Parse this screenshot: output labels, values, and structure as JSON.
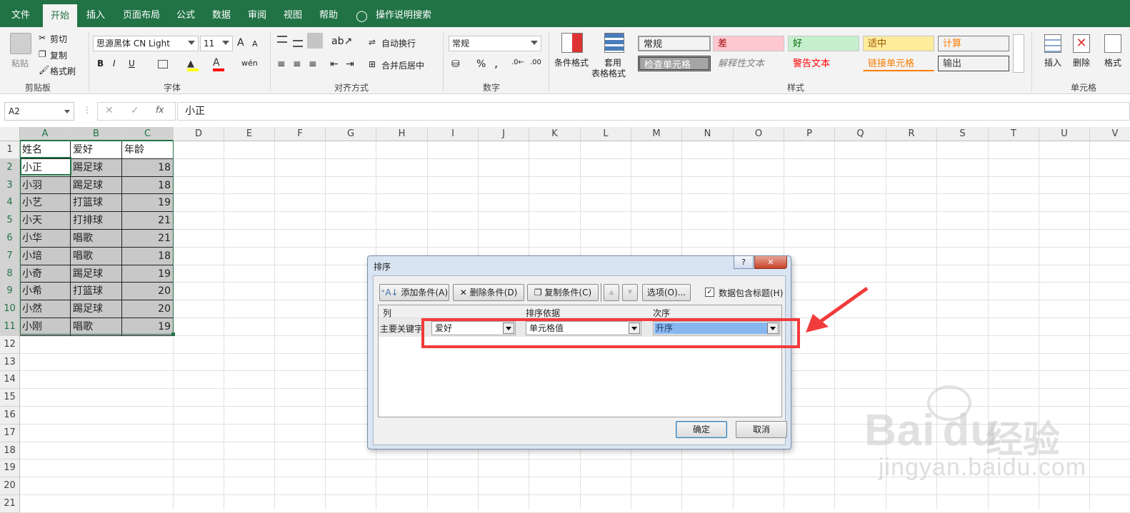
{
  "ribbon_tabs": [
    "文件",
    "开始",
    "插入",
    "页面布局",
    "公式",
    "数据",
    "审阅",
    "视图",
    "帮助",
    "操作说明搜索"
  ],
  "clipboard": {
    "paste": "粘贴",
    "cut": "剪切",
    "copy": "复制",
    "format_painter": "格式刷",
    "label": "剪贴板"
  },
  "font": {
    "name": "思源黑体 CN Light",
    "size": "11",
    "label": "字体",
    "bold": "B",
    "italic": "I",
    "underline": "U",
    "grow": "A",
    "shrink": "A",
    "font_color": "A",
    "phonetic": "wén"
  },
  "alignment": {
    "wrap": "自动换行",
    "merge": "合并后居中",
    "label": "对齐方式"
  },
  "number": {
    "format": "常规",
    "percent": "%",
    "comma": ",",
    "label": "数字"
  },
  "styles": {
    "conditional": "条件格式",
    "table_format_1": "套用",
    "table_format_2": "表格格式",
    "label": "样式",
    "cells": [
      {
        "text": "常规",
        "bg": "#ffffff",
        "color": "#000000"
      },
      {
        "text": "差",
        "bg": "#ffc7ce",
        "color": "#9c0006"
      },
      {
        "text": "好",
        "bg": "#c6efce",
        "color": "#006100"
      },
      {
        "text": "适中",
        "bg": "#ffeb9c",
        "color": "#9c5700"
      },
      {
        "text": "计算",
        "bg": "#f2f2f2",
        "color": "#fa7d00"
      },
      {
        "text": "检查单元格",
        "bg": "#a5a5a5",
        "color": "#ffffff"
      },
      {
        "text": "解释性文本",
        "bg": "#ffffff",
        "color": "#7f7f7f"
      },
      {
        "text": "警告文本",
        "bg": "#ffffff",
        "color": "#ff0000"
      },
      {
        "text": "链接单元格",
        "bg": "#ffffff",
        "color": "#fa7d00"
      },
      {
        "text": "输出",
        "bg": "#f2f2f2",
        "color": "#3f3f3f"
      }
    ]
  },
  "cells_group": {
    "insert": "插入",
    "delete": "删除",
    "format": "格式",
    "label": "单元格"
  },
  "formula_bar": {
    "name_box": "A2",
    "cancel": "✕",
    "enter": "✓",
    "fx": "fx",
    "value": "小正"
  },
  "columns": [
    "A",
    "B",
    "C",
    "D",
    "E",
    "F",
    "G",
    "H",
    "I",
    "J",
    "K",
    "L",
    "M",
    "N",
    "O",
    "P",
    "Q",
    "R",
    "S",
    "T",
    "U",
    "V"
  ],
  "rows": [
    "1",
    "2",
    "3",
    "4",
    "5",
    "6",
    "7",
    "8",
    "9",
    "10",
    "11",
    "12",
    "13",
    "14",
    "15",
    "16",
    "17",
    "18",
    "19",
    "20",
    "21"
  ],
  "sheet": [
    [
      "姓名",
      "爱好",
      "年龄"
    ],
    [
      "小正",
      "踢足球",
      "18"
    ],
    [
      "小羽",
      "踢足球",
      "18"
    ],
    [
      "小艺",
      "打篮球",
      "19"
    ],
    [
      "小天",
      "打排球",
      "21"
    ],
    [
      "小华",
      "唱歌",
      "21"
    ],
    [
      "小培",
      "唱歌",
      "18"
    ],
    [
      "小奇",
      "踢足球",
      "19"
    ],
    [
      "小希",
      "打篮球",
      "20"
    ],
    [
      "小然",
      "踢足球",
      "20"
    ],
    [
      "小刚",
      "唱歌",
      "19"
    ]
  ],
  "dialog": {
    "title": "排序",
    "help": "?",
    "close": "✕",
    "add": "添加条件(A)",
    "delete": "删除条件(D)",
    "copy": "复制条件(C)",
    "up": "▲",
    "down": "▼",
    "options": "选项(O)...",
    "has_header": "数据包含标题(H)",
    "col_header": "列",
    "basis_header": "排序依据",
    "order_header": "次序",
    "row_label": "主要关键字",
    "column_value": "爱好",
    "basis_value": "单元格值",
    "order_value": "升序",
    "ok": "确定",
    "cancel": "取消"
  },
  "watermark": {
    "brand": "Bai",
    "brand2": "du",
    "cn": "经验",
    "url": "jingyan.baidu.com"
  },
  "colors": {
    "excel_green": "#217346",
    "highlight_red": "#f23b3b",
    "selection_gray": "#c8c8c8"
  }
}
